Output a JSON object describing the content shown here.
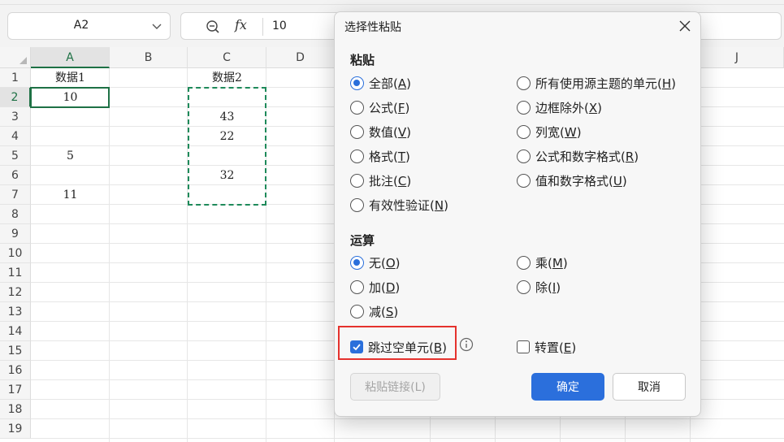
{
  "name_box": {
    "value": "A2"
  },
  "formula_bar": {
    "value": "10"
  },
  "grid": {
    "columns": [
      "A",
      "B",
      "C",
      "D",
      "",
      "",
      "",
      "",
      "",
      "J"
    ],
    "selected_column": "A",
    "rows": [
      "1",
      "2",
      "3",
      "4",
      "5",
      "6",
      "7",
      "8",
      "9",
      "10",
      "11",
      "12",
      "13",
      "14",
      "15",
      "16",
      "17",
      "18",
      "19"
    ],
    "selected_row": "2",
    "cells": {
      "A1": "数据1",
      "C1": "数据2",
      "A2": "10",
      "C3": "43",
      "C4": "22",
      "A5": "5",
      "C6": "32",
      "A7": "11"
    }
  },
  "dialog": {
    "title": "选择性粘贴",
    "paste_section": "粘贴",
    "paste_options": [
      {
        "label": "全部(A)",
        "selected": true
      },
      {
        "label": "公式(F)",
        "selected": false
      },
      {
        "label": "数值(V)",
        "selected": false
      },
      {
        "label": "格式(T)",
        "selected": false
      },
      {
        "label": "批注(C)",
        "selected": false
      },
      {
        "label": "有效性验证(N)",
        "selected": false
      },
      {
        "label": "所有使用源主题的单元(H)",
        "selected": false
      },
      {
        "label": "边框除外(X)",
        "selected": false
      },
      {
        "label": "列宽(W)",
        "selected": false
      },
      {
        "label": "公式和数字格式(R)",
        "selected": false
      },
      {
        "label": "值和数字格式(U)",
        "selected": false
      }
    ],
    "operation_section": "运算",
    "operation_options": [
      {
        "label": "无(O)",
        "selected": true
      },
      {
        "label": "加(D)",
        "selected": false
      },
      {
        "label": "减(S)",
        "selected": false
      },
      {
        "label": "乘(M)",
        "selected": false
      },
      {
        "label": "除(I)",
        "selected": false
      }
    ],
    "skip_blanks": {
      "label": "跳过空单元(B)",
      "checked": true
    },
    "transpose": {
      "label": "转置(E)",
      "checked": false
    },
    "paste_link_button": "粘贴链接(L)",
    "ok_button": "确定",
    "cancel_button": "取消"
  },
  "colors": {
    "accent_green": "#1e7145",
    "primary_blue": "#2b6fdc",
    "highlight_red": "#e5322d"
  }
}
